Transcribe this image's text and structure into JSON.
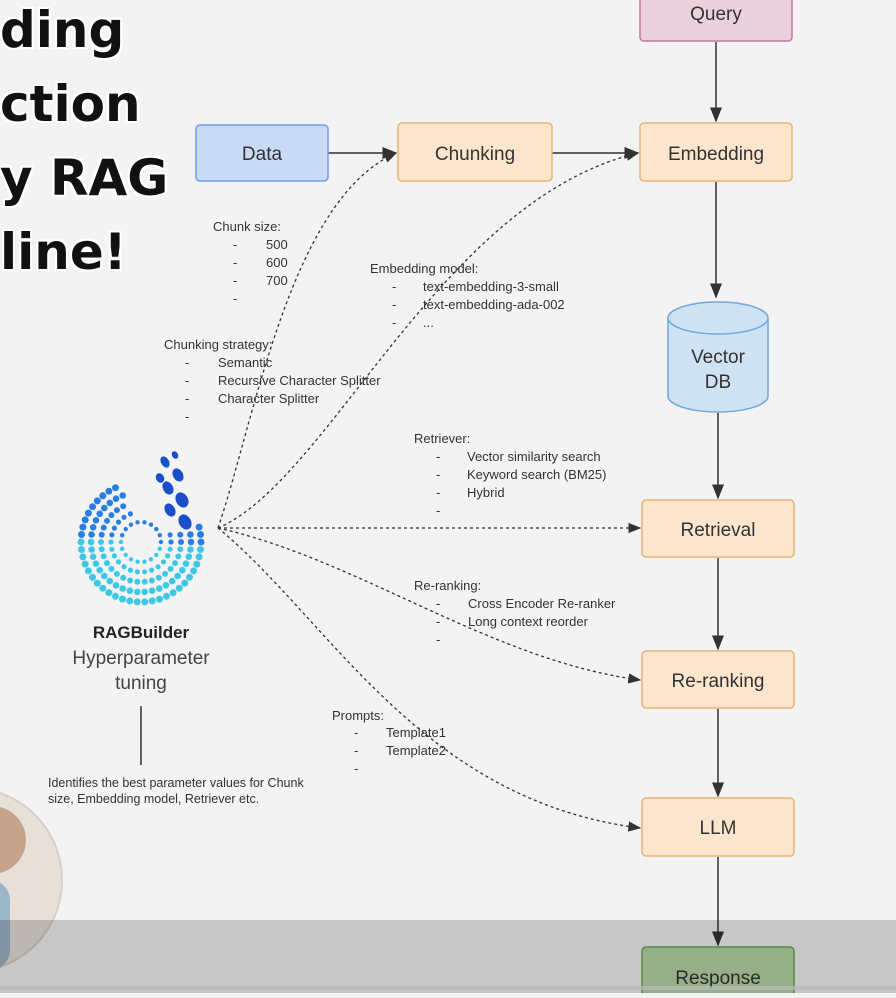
{
  "title_lines": [
    "ding",
    "ction",
    "y RAG",
    "line!"
  ],
  "nodes": {
    "query": "Query",
    "data": "Data",
    "chunking": "Chunking",
    "embedding": "Embedding",
    "vector_db": [
      "Vector",
      "DB"
    ],
    "retrieval": "Retrieval",
    "reranking": "Re-ranking",
    "llm": "LLM",
    "response": "Response"
  },
  "notes": {
    "chunk_size": {
      "label": "Chunk size:",
      "items": [
        "500",
        "600",
        "700",
        ""
      ]
    },
    "chunking_strategy": {
      "label": "Chunking strategy:",
      "items": [
        "Semantic",
        "Recursive Character Splitter",
        "Character Splitter",
        ""
      ]
    },
    "embedding_model": {
      "label": "Embedding model:",
      "items": [
        "text-embedding-3-small",
        "text-embedding-ada-002",
        "..."
      ]
    },
    "retriever": {
      "label": "Retriever:",
      "items": [
        "Vector similarity search",
        "Keyword search (BM25)",
        "Hybrid",
        ""
      ]
    },
    "reranking": {
      "label": "Re-ranking:",
      "items": [
        "Cross Encoder Re-ranker",
        "Long context reorder",
        ""
      ]
    },
    "prompts": {
      "label": "Prompts:",
      "items": [
        "Template1",
        "Template2",
        ""
      ]
    }
  },
  "brand": {
    "name": "RAGBuilder",
    "subtitle_1": "Hyperparameter",
    "subtitle_2": "tuning",
    "logo_icon": "ragbuilder-dotted-ring-logo"
  },
  "caption": "Identifies the best parameter values for Chunk size, Embedding model, Retriever etc.",
  "colors": {
    "data_fill": "#c9daf8",
    "data_stroke": "#6d9eeb",
    "stage_fill": "#fce5cd",
    "stage_stroke": "#e8b27a",
    "query_fill": "#ead1dc",
    "query_stroke": "#c27ba0",
    "response_fill": "#b6d7a8",
    "response_stroke": "#6aa84f",
    "db_fill": "#cfe2f3",
    "db_stroke": "#6fa8dc"
  }
}
